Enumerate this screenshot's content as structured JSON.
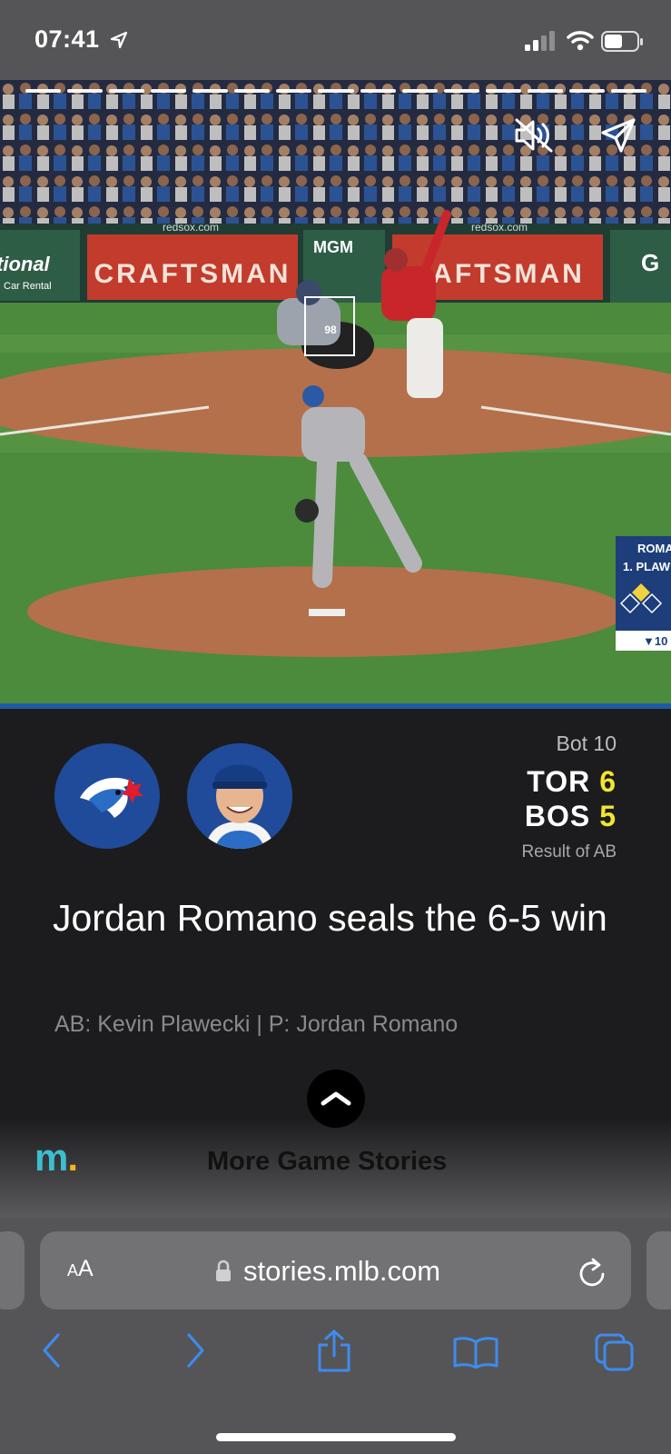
{
  "status_bar": {
    "time": "07:41"
  },
  "video": {
    "signage": {
      "left_ad": "tional",
      "left_ad_sub": "Car Rental",
      "url_1": "redsox.com",
      "url_2": "redsox.com",
      "ad_main": "CRAFTSMAN",
      "ad_main_2": "AFTSMAN",
      "mgm": "MGM",
      "right_ad": "G",
      "catcher_number": "98"
    },
    "mini_score": {
      "name": "ROMA",
      "batter": "1. PLAW",
      "inning": "▼10"
    },
    "progress_segments": 15
  },
  "card": {
    "inning": "Bot 10",
    "teams": [
      {
        "abbr": "TOR",
        "score": "6"
      },
      {
        "abbr": "BOS",
        "score": "5"
      }
    ],
    "result_label": "Result of AB",
    "headline": "Jordan Romano seals the 6-5 win",
    "matchup": "AB: Kevin Plawecki | P: Jordan Romano"
  },
  "more": {
    "logo": "m",
    "logo_dot": ".",
    "label": "More Game Stories"
  },
  "safari": {
    "aa_small": "A",
    "aa_big": "A",
    "url": "stories.mlb.com"
  },
  "colors": {
    "score_yellow": "#f2e62f",
    "blue_jays": "#1f4b9a",
    "link_blue": "#3d8bf0",
    "m_logo": "#3bbfd0"
  }
}
